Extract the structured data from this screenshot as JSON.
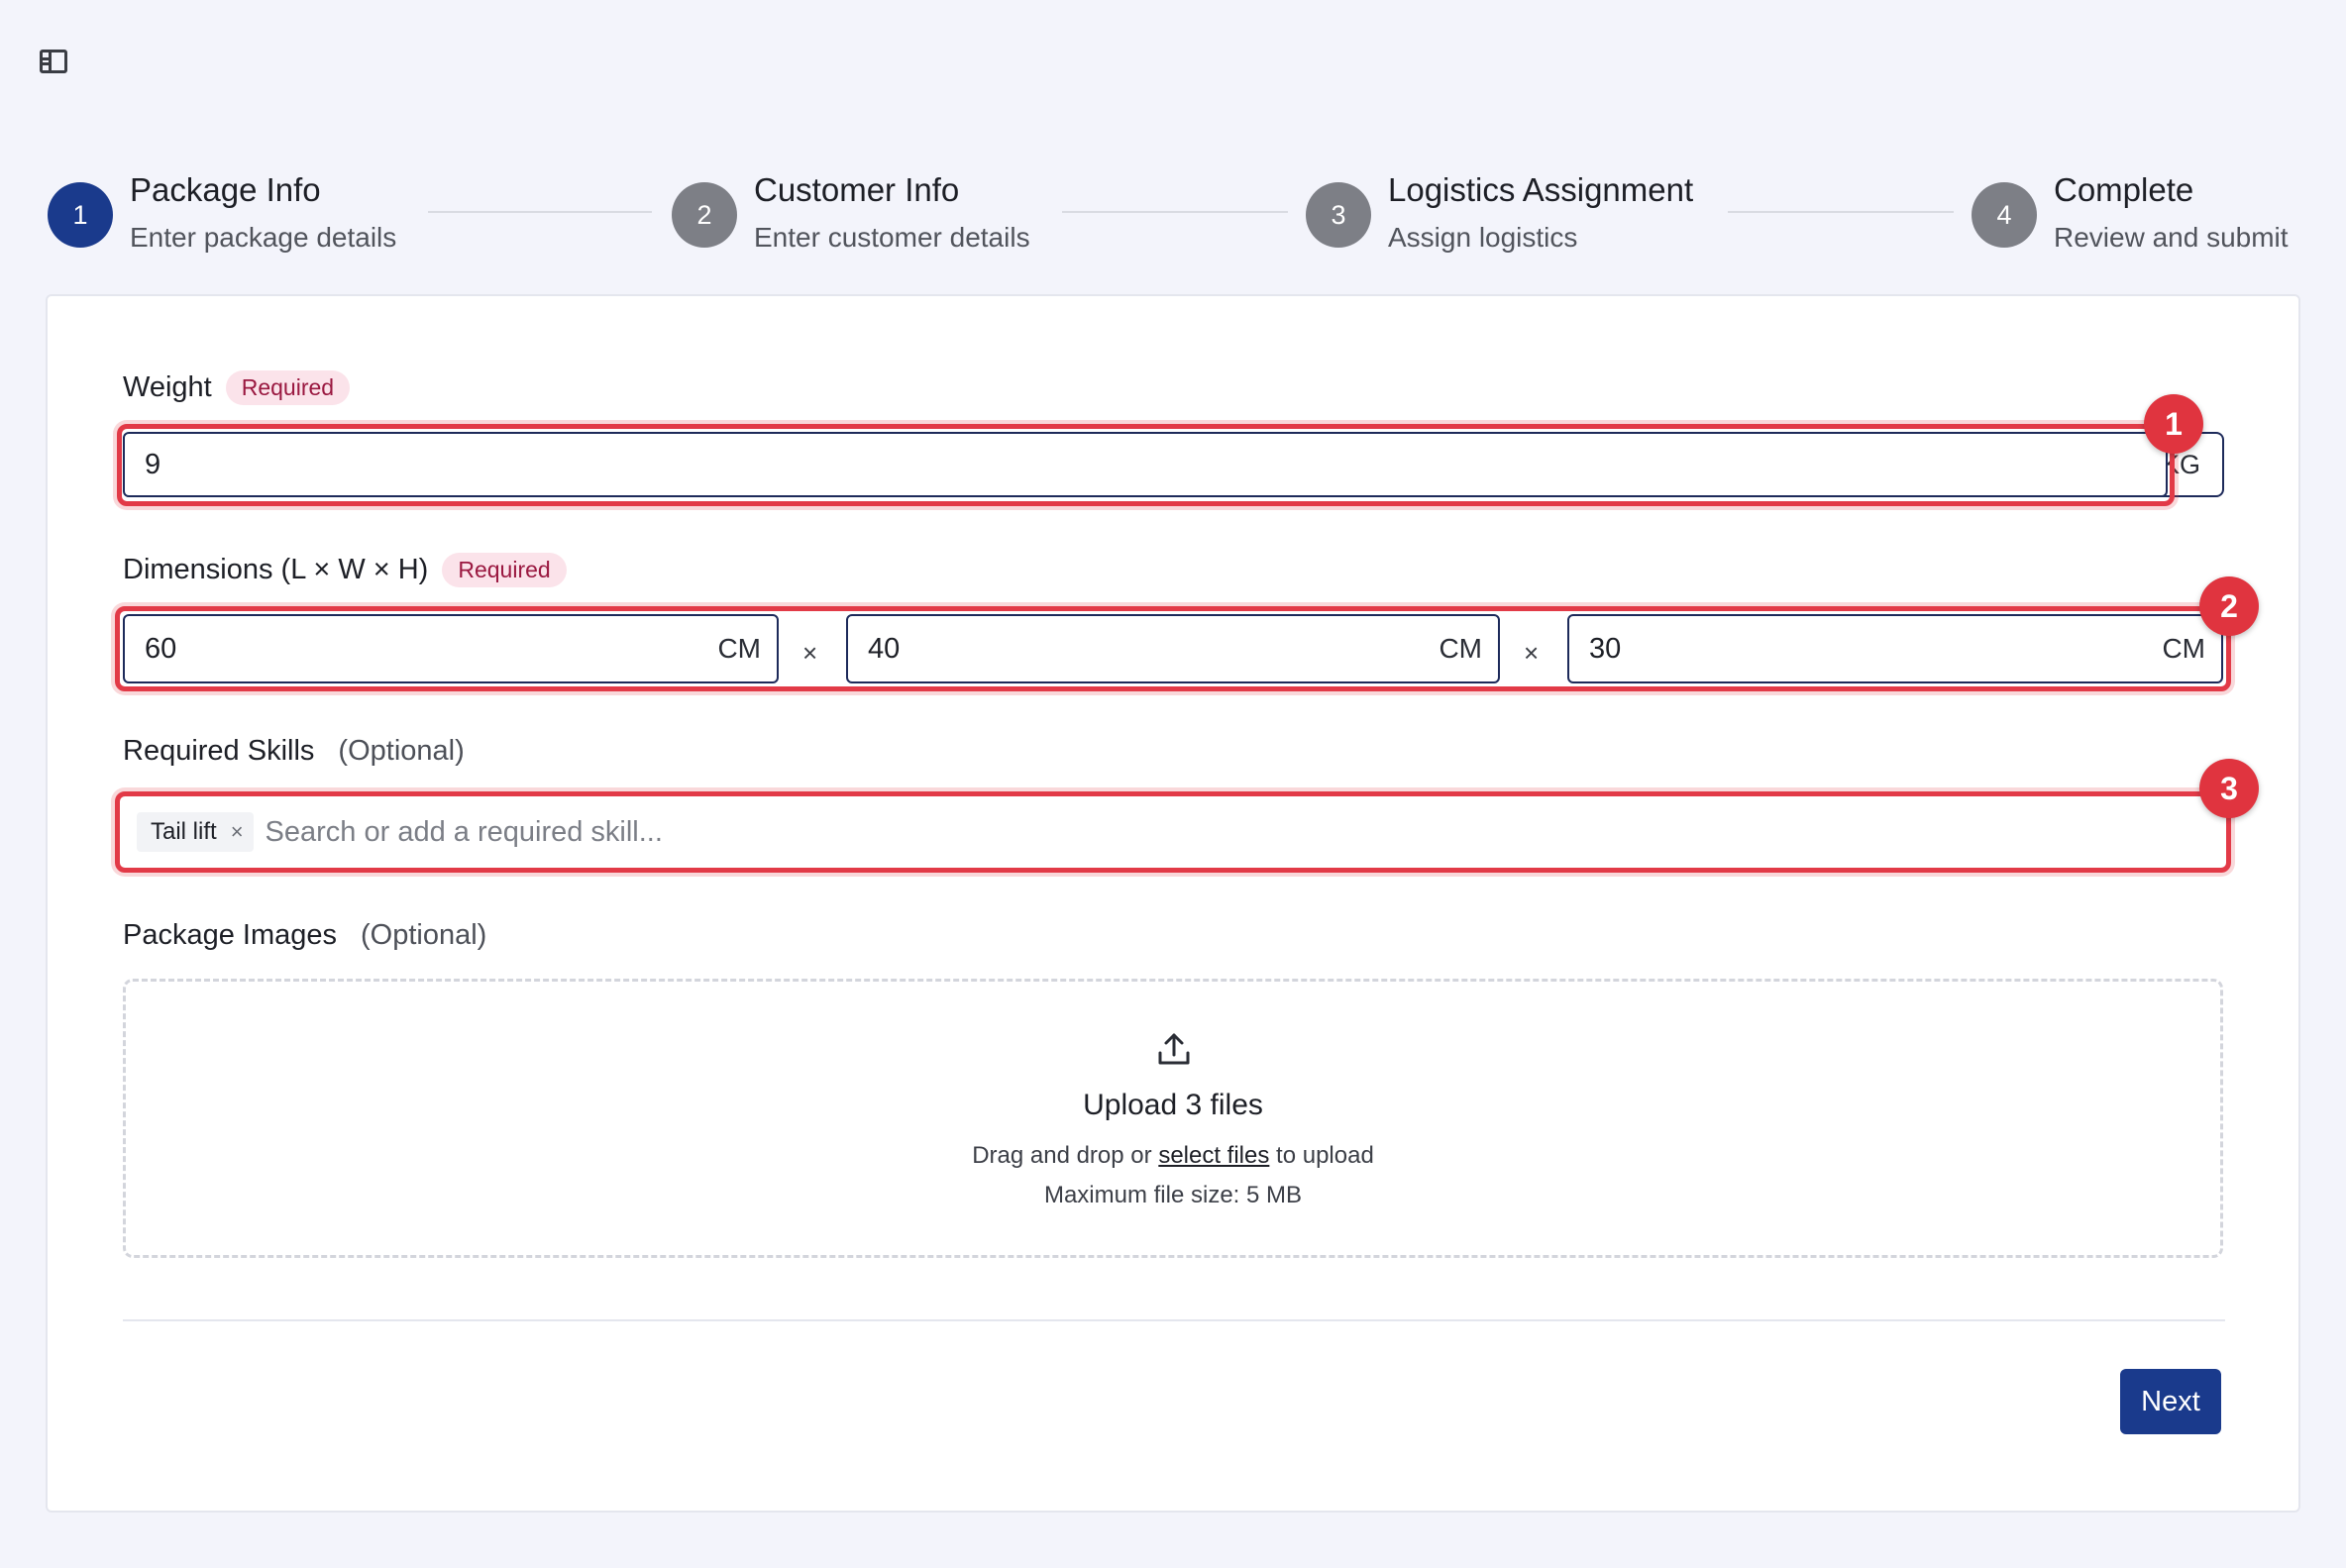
{
  "app": {
    "sidebar_toggle_icon": "sidebar-panel-icon"
  },
  "stepper": {
    "steps": [
      {
        "number": "1",
        "title": "Package Info",
        "subtitle": "Enter package details",
        "state": "active"
      },
      {
        "number": "2",
        "title": "Customer Info",
        "subtitle": "Enter customer details",
        "state": "pending"
      },
      {
        "number": "3",
        "title": "Logistics Assignment",
        "subtitle": "Assign logistics",
        "state": "pending"
      },
      {
        "number": "4",
        "title": "Complete",
        "subtitle": "Review and submit",
        "state": "pending"
      }
    ]
  },
  "form": {
    "weight": {
      "label": "Weight",
      "badge": "Required",
      "value": "9",
      "unit": "KG"
    },
    "dimensions": {
      "label": "Dimensions (L × W × H)",
      "badge": "Required",
      "separator": "×",
      "length": {
        "value": "60",
        "unit": "CM"
      },
      "width": {
        "value": "40",
        "unit": "CM"
      },
      "height": {
        "value": "30",
        "unit": "CM"
      }
    },
    "skills": {
      "label": "Required Skills",
      "optional": "(Optional)",
      "chips": [
        "Tail lift"
      ],
      "chip_remove": "×",
      "placeholder": "Search or add a required skill..."
    },
    "images": {
      "label": "Package Images",
      "optional": "(Optional)",
      "icon": "upload-icon",
      "title": "Upload 3 files",
      "hint_prefix": "Drag and drop or",
      "hint_link": "select files",
      "hint_suffix": "to upload",
      "max_size": "Maximum file size: 5 MB"
    },
    "next_label": "Next"
  },
  "annotations": {
    "markers": [
      "1",
      "2",
      "3"
    ],
    "highlight_color": "#e23a47"
  },
  "colors": {
    "primary": "#1a3a8c",
    "inactive_step": "#7d7f86",
    "required_badge_bg": "#fbe3ea",
    "required_badge_text": "#9a1840",
    "background": "#f3f4fb"
  }
}
